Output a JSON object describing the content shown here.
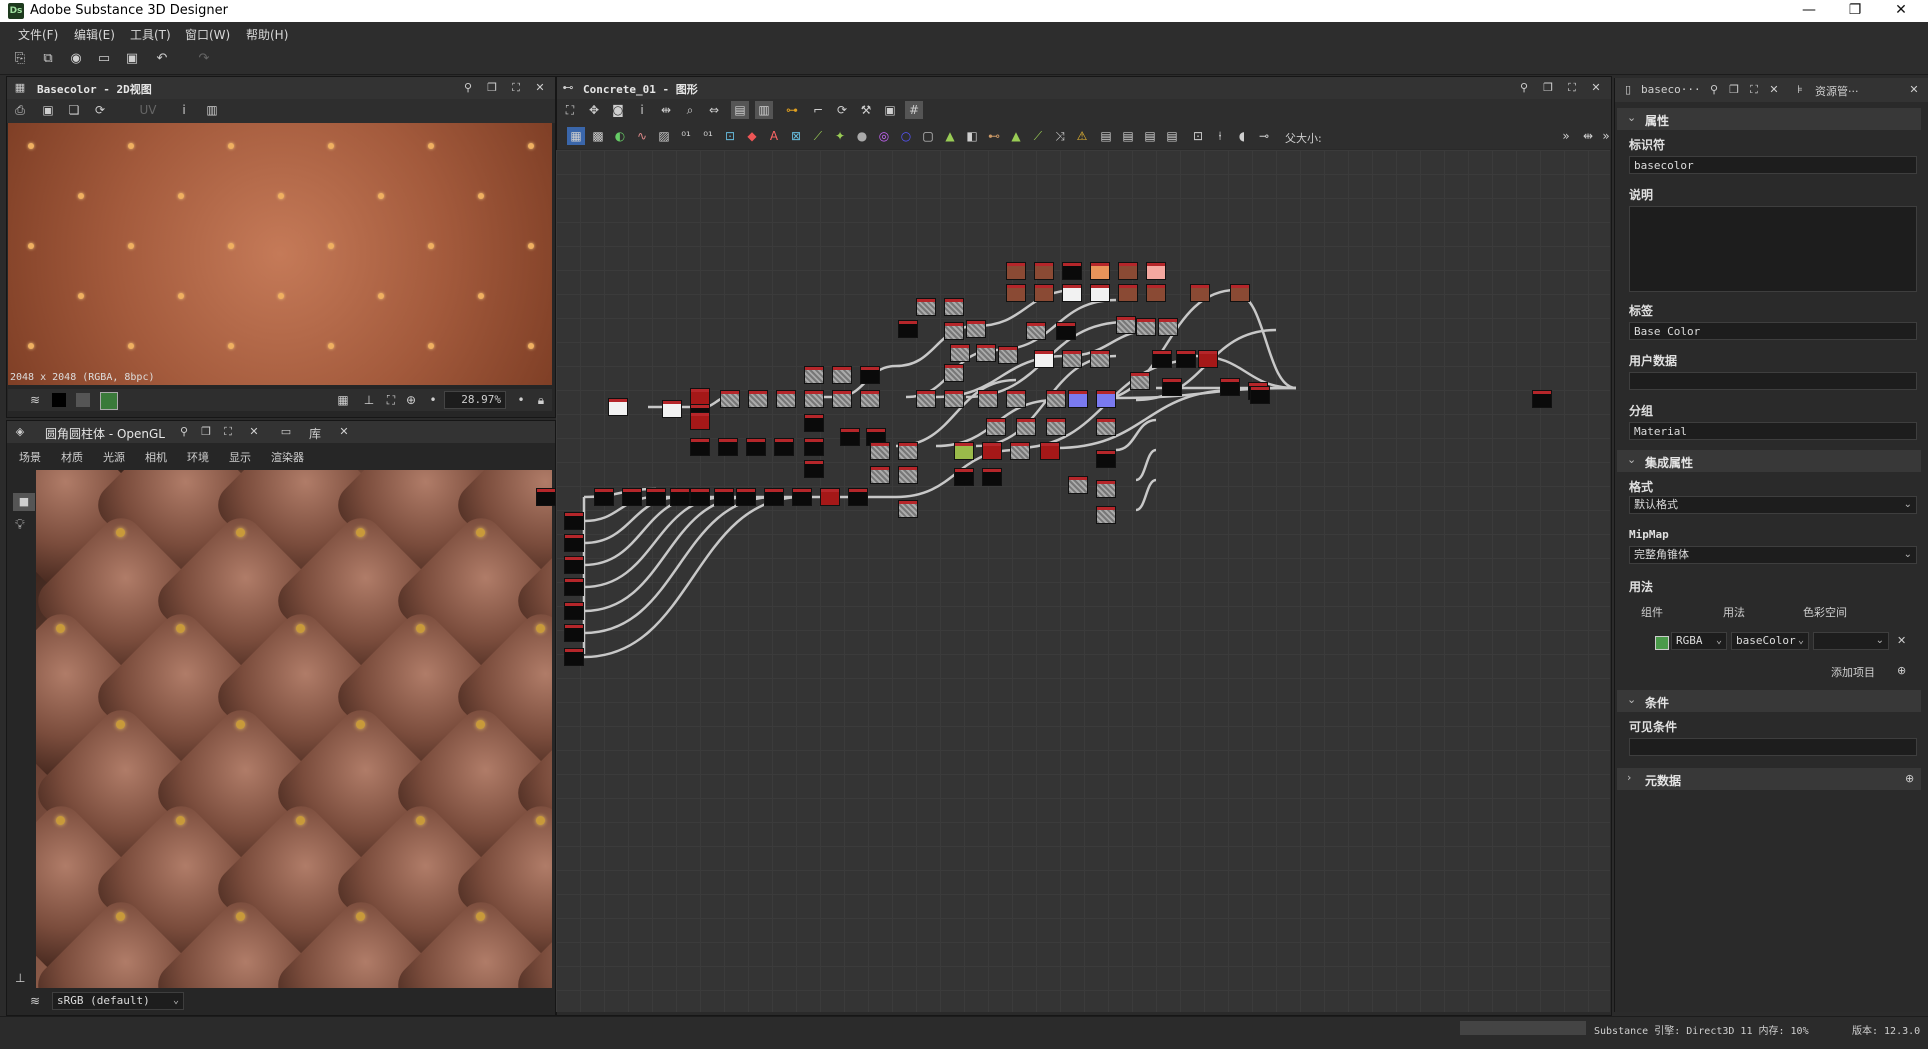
{
  "app": {
    "title": "Adobe Substance 3D Designer",
    "logo": "Ds",
    "window_buttons": [
      "—",
      "❐",
      "✕"
    ]
  },
  "menu": [
    "文件(F)",
    "编辑(E)",
    "工具(T)",
    "窗口(W)",
    "帮助(H)"
  ],
  "view2d": {
    "title": "Basecolor - 2D视图",
    "info": "2048 x 2048 (RGBA, 8bpc)",
    "zoom": "28.97%"
  },
  "view3d": {
    "title": "圆角圆柱体 - OpenGL",
    "tab2": "库",
    "menu": [
      "场景",
      "材质",
      "光源",
      "相机",
      "环境",
      "显示",
      "渲染器"
    ],
    "colorspace": "sRGB (default)"
  },
  "graph": {
    "title": "Concrete_01 - 图形",
    "parent_size_label": "父大小:"
  },
  "rightpanel": {
    "tab1": "baseco···",
    "tab2": "资源管···",
    "sections": {
      "attributes": "属性",
      "output_attributes": "集成属性",
      "conditions": "条件",
      "metadata": "元数据"
    },
    "identifier_label": "标识符",
    "identifier_value": "basecolor",
    "description_label": "说明",
    "label_label": "标签",
    "label_value": "Base Color",
    "userdata_label": "用户数据",
    "group_label": "分组",
    "group_value": "Material",
    "format_label": "格式",
    "format_value": "默认格式",
    "mipmap_label": "MipMap",
    "mipmap_value": "完整角锥体",
    "usage_label": "用法",
    "usage_col1": "组件",
    "usage_col2": "用法",
    "usage_col3": "色彩空间",
    "usage_component": "RGBA",
    "usage_value": "baseColor",
    "add_item": "添加项目",
    "visible_condition_label": "可见条件"
  },
  "status": {
    "engine": "Substance 引擎: Direct3D 11 内存: 10%",
    "version": "版本: 12.3.0"
  },
  "colors": {
    "accent_red": "#b5262a",
    "leather": "#a35a3c",
    "graph_bg": "#343434"
  }
}
